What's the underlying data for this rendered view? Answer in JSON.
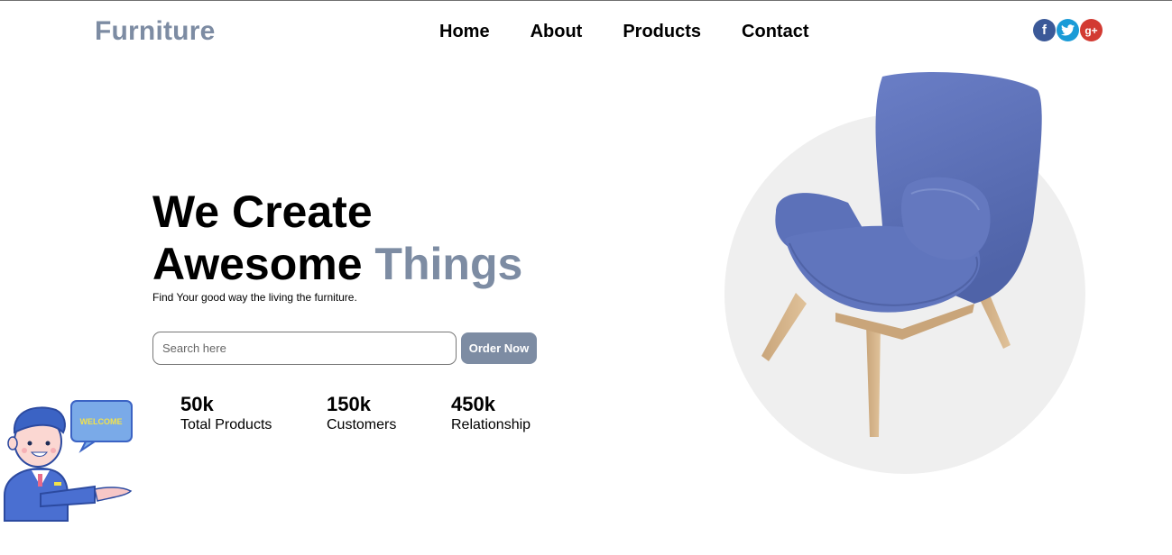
{
  "brand": {
    "name": "Furniture"
  },
  "nav": {
    "items": [
      "Home",
      "About",
      "Products",
      "Contact"
    ]
  },
  "social": [
    {
      "icon": "facebook-icon",
      "glyph": "f",
      "color": "#3b5998"
    },
    {
      "icon": "twitter-icon",
      "glyph": "t",
      "color": "#1a9bd7"
    },
    {
      "icon": "google-plus-icon",
      "glyph": "g+",
      "color": "#d23a32"
    }
  ],
  "hero": {
    "line1": "We Create",
    "line2_main": "Awesome ",
    "line2_accent": "Things",
    "subtitle": "Find Your good way the living the furniture."
  },
  "search": {
    "placeholder": "Search here",
    "value": "",
    "button_label": "Order Now"
  },
  "stats": [
    {
      "value": "50k",
      "label": "Total Products"
    },
    {
      "value": "150k",
      "label": "Customers"
    },
    {
      "value": "450k",
      "label": "Relationship"
    }
  ],
  "mascot": {
    "bubble_text": "WELCOME"
  },
  "colors": {
    "accent": "#7d8ca3",
    "chair": "#5a6fb8",
    "circle": "#efefef"
  }
}
